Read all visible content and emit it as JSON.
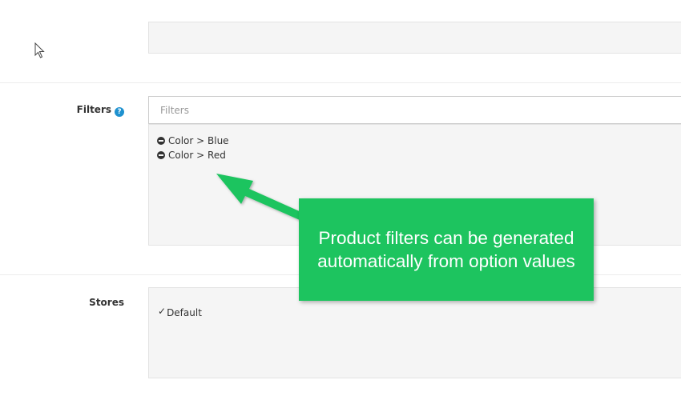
{
  "filters": {
    "label": "Filters",
    "help_icon": "?",
    "input_placeholder": "Filters",
    "items": [
      {
        "text": "Color > Blue"
      },
      {
        "text": "Color > Red"
      }
    ]
  },
  "stores": {
    "label": "Stores",
    "items": [
      {
        "text": "Default",
        "checked": true
      }
    ]
  },
  "callout": {
    "text": "Product filters can be generated automatically from option values",
    "color": "#1dc45f"
  },
  "colors": {
    "help_icon": "#1e91cf",
    "well_background": "#f5f5f5"
  }
}
